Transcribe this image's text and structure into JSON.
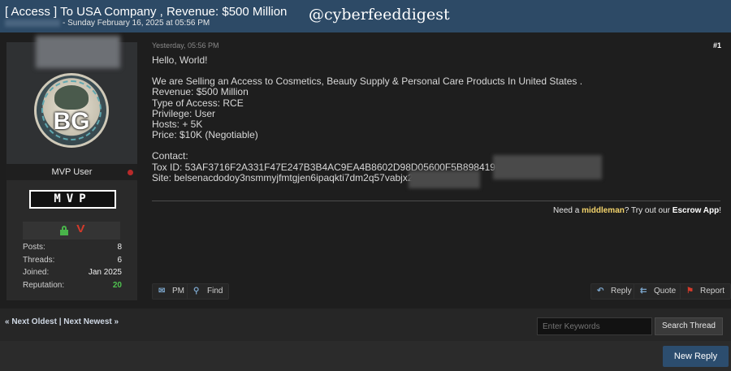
{
  "header": {
    "title": "[ Access ] To USA Company , Revenue: $500 Million",
    "meta": "- Sunday February 16, 2025 at 05:56 PM",
    "watermark": "@cyberfeeddigest"
  },
  "user": {
    "avatar_initials": "BG",
    "role": "MVP User",
    "badge": "MVP",
    "stats": [
      {
        "label": "Posts:",
        "value": "8"
      },
      {
        "label": "Threads:",
        "value": "6"
      },
      {
        "label": "Joined:",
        "value": "Jan 2025"
      },
      {
        "label": "Reputation:",
        "value": "20"
      }
    ],
    "status_colors": {
      "online_dot": "#b82a2a",
      "lock": "#49b44a",
      "reputation": "#4fc24f"
    }
  },
  "post": {
    "date": "Yesterday, 05:56 PM",
    "number": "#1",
    "greeting": "Hello, World!",
    "lines": [
      "We are Selling an Access to Cosmetics, Beauty Supply & Personal Care Products In United States .",
      "Revenue: $500 Million",
      "Type of Access: RCE",
      "Privilege: User",
      "Hosts: + 5K",
      "Price: $10K (Negotiable)"
    ],
    "contact_label": "Contact:",
    "tox_id": "Tox ID: 53AF3716F2A331F47E247B3B4AC9EA4B8602D98D05600F5B898419CB3",
    "site": "Site: belsenacdodoy3nsmmyjfmtgjen6ipaqkti7dm2q57vabjx2v",
    "escrow": {
      "prefix": "Need a ",
      "middleman": "middleman",
      "middle": "? Try out our ",
      "app": "Escrow App",
      "suffix": "!"
    },
    "buttons": {
      "pm": "PM",
      "find": "Find",
      "reply": "Reply",
      "quote": "Quote",
      "report": "Report"
    }
  },
  "footer": {
    "next_oldest": "« Next Oldest",
    "separator": " | ",
    "next_newest": "Next Newest »",
    "search_placeholder": "Enter Keywords",
    "search_button": "Search Thread",
    "new_reply": "New Reply"
  },
  "colors": {
    "header_bg": "#2d4a66",
    "accent_button": "#2c4d6e",
    "escrow_highlight": "#f3d36b"
  }
}
